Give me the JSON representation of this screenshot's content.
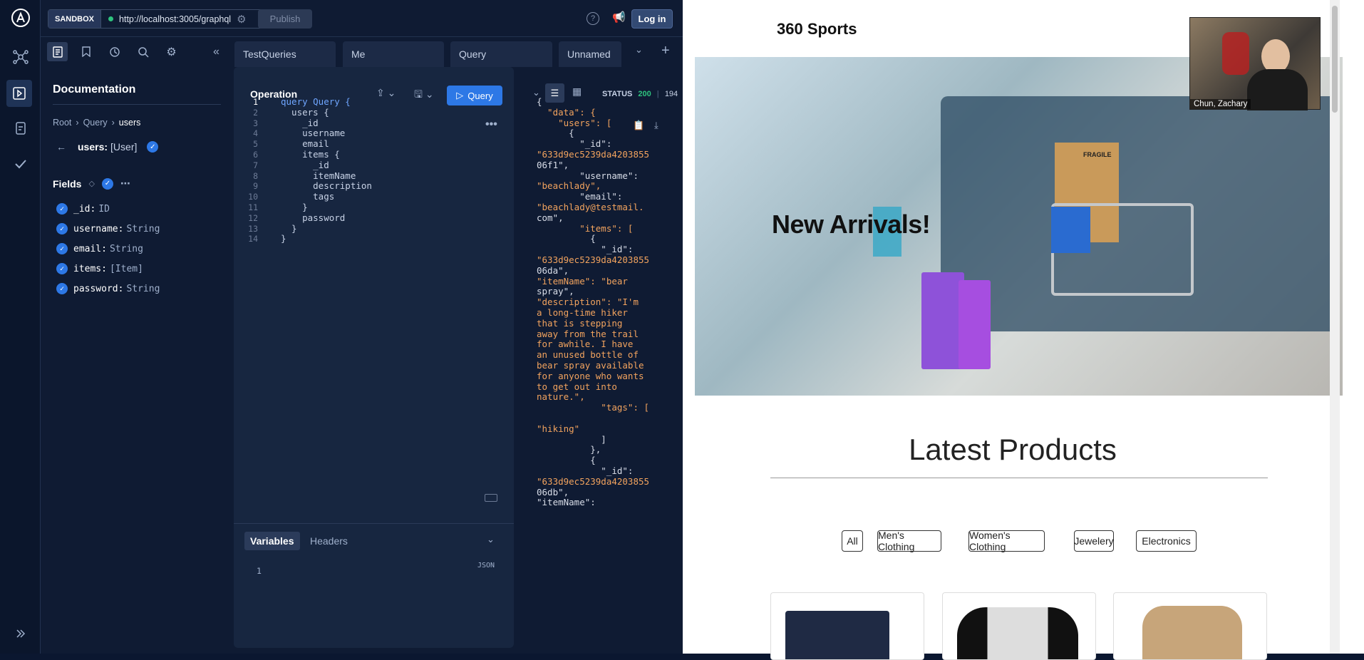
{
  "sandbox": {
    "tag": "SANDBOX",
    "url": "http://localhost:3005/graphql",
    "publish": "Publish",
    "login": "Log in"
  },
  "tabs": [
    "TestQueries",
    "Me",
    "Query",
    "Unnamed"
  ],
  "docs": {
    "title": "Documentation",
    "crumbs": [
      "Root",
      "Query",
      "users"
    ],
    "type_name": "users:",
    "type_val": "[User]",
    "fields_label": "Fields",
    "fields": [
      {
        "name": "_id:",
        "type": "ID"
      },
      {
        "name": "username:",
        "type": "String"
      },
      {
        "name": "email:",
        "type": "String"
      },
      {
        "name": "items:",
        "type": "[Item]"
      },
      {
        "name": "password:",
        "type": "String"
      }
    ]
  },
  "operation": {
    "title": "Operation",
    "run": "Query",
    "lines": [
      "query Query {",
      "  users {",
      "    _id",
      "    username",
      "    email",
      "    items {",
      "      _id",
      "      itemName",
      "      description",
      "      tags",
      "    }",
      "    password",
      "  }",
      "}"
    ],
    "line_numbers": [
      "1",
      "2",
      "3",
      "4",
      "5",
      "6",
      "7",
      "8",
      "9",
      "10",
      "11",
      "12",
      "13",
      "14"
    ],
    "vars_tab": "Variables",
    "headers_tab": "Headers",
    "json_label": "JSON",
    "var_line": "1"
  },
  "response": {
    "status_label": "STATUS",
    "status_code": "200",
    "size": "194",
    "lines": [
      "{",
      "  \"data\": {",
      "    \"users\": [",
      "      {",
      "        \"_id\":",
      "\"633d9ec5239da4203855",
      "06f1\",",
      "        \"username\":",
      "\"beachlady\",",
      "        \"email\":",
      "\"beachlady@testmail.",
      "com\",",
      "        \"items\": [",
      "          {",
      "            \"_id\":",
      "\"633d9ec5239da4203855",
      "06da\",",
      "\"itemName\": \"bear",
      "spray\",",
      "\"description\": \"I'm",
      "a long-time hiker",
      "that is stepping",
      "away from the trail",
      "for awhile. I have",
      "an unused bottle of",
      "bear spray available",
      "for anyone who wants",
      "to get out into",
      "nature.\",",
      "            \"tags\": [",
      "",
      "\"hiking\"",
      "            ]",
      "          },",
      "          {",
      "            \"_id\":",
      "\"633d9ec5239da4203855",
      "06db\",",
      "\"itemName\":"
    ]
  },
  "site": {
    "brand": "360 Sports",
    "hero_text": "New Arrivals!",
    "section_title": "Latest Products",
    "filters": [
      "All",
      "Men's Clothing",
      "Women's Clothing",
      "Jewelery",
      "Electronics"
    ],
    "video_name": "Chun, Zachary",
    "fragile": "FRAGILE"
  }
}
